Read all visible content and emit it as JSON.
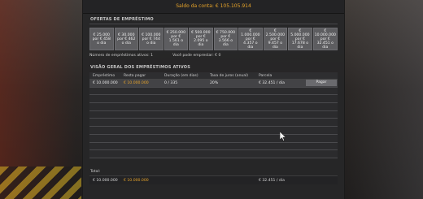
{
  "balance": {
    "label": "Saldo da conta:",
    "value": "€ 105.105.914"
  },
  "offers_title": "OFERTAS DE EMPRÉSTIMO",
  "offers": [
    "€ 25.000 por € 458 o dia",
    "€ 30.000 por € 462 o dia",
    "€ 100.000 por € 744 o dia",
    "€ 250.000 por € 1.561 o dia",
    "€ 500.000 por € 2.095 o dia",
    "€ 750.000 por € 3.566 o dia",
    "€ 1.000.000 por € 4.357 o dia",
    "€ 2.500.000 por € 9.457 o dia",
    "€ 5.000.000 por € 17.678 o dia",
    "€ 10.000.000 por € 32.451 o dia"
  ],
  "info": {
    "active_loans": "Número de empréstimos ativos: 1",
    "can_borrow": "Você pode emprestar: € 0"
  },
  "overview_title": "VISÃO GERAL DOS EMPRÉSTIMOS ATIVOS",
  "table": {
    "headers": [
      "Empréstimo",
      "Resta pagar",
      "Duração (em dias)",
      "Taxa de juros (anual)",
      "Parcela",
      ""
    ],
    "rows": [
      [
        "€ 10.000.000",
        "€ 10.000.000",
        "0 / 335",
        "20%",
        "€ 32.451 / dia"
      ]
    ],
    "pay_label": "Pagar"
  },
  "total": {
    "label": "Total:",
    "loan": "€ 10.000.000",
    "remaining": "€ 10.000.000",
    "installment": "€ 32.451 / dia"
  },
  "colors": {
    "accent": "#e9a52a",
    "panel": "#262628",
    "button": "#5d5d60"
  }
}
